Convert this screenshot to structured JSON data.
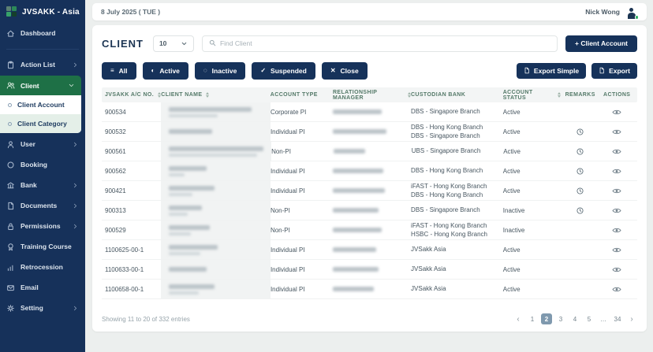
{
  "colors": {
    "sidebar_navy": "#16315a",
    "active_green": "#1e7046",
    "submenu_light_green": "#e4efe8",
    "button_navy": "#16325a",
    "table_header_green": "#547968",
    "pagination_active": "#7f99ae",
    "status_online_green": "#2fae63"
  },
  "header": {
    "date": "8 July 2025 ( TUE )",
    "user_name": "Nick Wong"
  },
  "sidebar": {
    "brand": "JVSAKK - Asia",
    "items": [
      {
        "label": "Dashboard",
        "icon": "home-icon"
      },
      {
        "label": "Action List",
        "icon": "clipboard-icon",
        "chevron": "right"
      },
      {
        "label": "Client",
        "icon": "users-icon",
        "chevron": "down",
        "active": true,
        "children": [
          {
            "label": "Client Account",
            "selected": true
          },
          {
            "label": "Client Category"
          }
        ]
      },
      {
        "label": "User",
        "icon": "user-icon",
        "chevron": "right"
      },
      {
        "label": "Booking",
        "icon": "circle-icon"
      },
      {
        "label": "Bank",
        "icon": "bank-icon",
        "chevron": "right"
      },
      {
        "label": "Documents",
        "icon": "document-icon",
        "chevron": "right"
      },
      {
        "label": "Permissions",
        "icon": "lock-icon",
        "chevron": "right"
      },
      {
        "label": "Training Course",
        "icon": "badge-icon"
      },
      {
        "label": "Retrocession",
        "icon": "chart-icon"
      },
      {
        "label": "Email",
        "icon": "envelope-icon"
      },
      {
        "label": "Setting",
        "icon": "gear-icon",
        "chevron": "right"
      }
    ]
  },
  "toolbar": {
    "title": "CLIENT",
    "page_size": "10",
    "search_placeholder": "Find Client",
    "add_button": "+ Client Account"
  },
  "filters": [
    {
      "label": "All",
      "icon": "menu-icon"
    },
    {
      "label": "Active",
      "icon": "contrast-icon"
    },
    {
      "label": "Inactive",
      "icon": "dotted-circle-icon"
    },
    {
      "label": "Suspended",
      "icon": "check-icon"
    },
    {
      "label": "Close",
      "icon": "x-icon"
    }
  ],
  "export": {
    "simple": "Export Simple",
    "full": "Export"
  },
  "table": {
    "columns": [
      {
        "label": "JVSAKK A/C NO.",
        "sortable": true
      },
      {
        "label": "CLIENT NAME",
        "sortable": true
      },
      {
        "label": "ACCOUNT TYPE",
        "sortable": false
      },
      {
        "label": "RELATIONSHIP MANAGER",
        "sortable": true
      },
      {
        "label": "CUSTODIAN BANK",
        "sortable": false
      },
      {
        "label": "ACCOUNT STATUS",
        "sortable": true
      },
      {
        "label": "REMARKS",
        "sortable": false
      },
      {
        "label": "ACTIONS",
        "sortable": false
      }
    ],
    "rows": [
      {
        "acc_no": "900534",
        "client_name_redacted": true,
        "name_lines": [
          105,
          62
        ],
        "type": "Corporate PI",
        "rm_redacted": true,
        "rm_w": 62,
        "banks": [
          "DBS - Singapore Branch"
        ],
        "status": "Active",
        "remark_clock": false
      },
      {
        "acc_no": "900532",
        "client_name_redacted": true,
        "name_lines": [
          55
        ],
        "type": "Individual PI",
        "rm_redacted": true,
        "rm_w": 68,
        "banks": [
          "DBS - Hong Kong Branch",
          "DBS - Singapore Branch"
        ],
        "status": "Active",
        "remark_clock": true
      },
      {
        "acc_no": "900561",
        "client_name_redacted": true,
        "name_lines": [
          120,
          112
        ],
        "type": "Non-PI",
        "rm_redacted": true,
        "rm_w": 40,
        "banks": [
          "UBS - Singapore Branch"
        ],
        "status": "Active",
        "remark_clock": true
      },
      {
        "acc_no": "900562",
        "client_name_redacted": true,
        "name_lines": [
          48,
          20
        ],
        "type": "Individual PI",
        "rm_redacted": true,
        "rm_w": 64,
        "banks": [
          "DBS - Hong Kong Branch"
        ],
        "status": "Active",
        "remark_clock": true
      },
      {
        "acc_no": "900421",
        "client_name_redacted": true,
        "name_lines": [
          58,
          30
        ],
        "type": "Individual PI",
        "rm_redacted": true,
        "rm_w": 66,
        "banks": [
          "iFAST - Hong Kong Branch",
          "DBS - Hong Kong Branch"
        ],
        "status": "Active",
        "remark_clock": true
      },
      {
        "acc_no": "900313",
        "client_name_redacted": true,
        "name_lines": [
          42,
          24
        ],
        "type": "Non-PI",
        "rm_redacted": true,
        "rm_w": 58,
        "banks": [
          "DBS - Singapore Branch"
        ],
        "status": "Inactive",
        "remark_clock": true
      },
      {
        "acc_no": "900529",
        "client_name_redacted": true,
        "name_lines": [
          52,
          28
        ],
        "type": "Non-PI",
        "rm_redacted": true,
        "rm_w": 62,
        "banks": [
          "iFAST - Hong Kong Branch",
          "HSBC - Hong Kong Branch"
        ],
        "status": "Inactive",
        "remark_clock": false
      },
      {
        "acc_no": "1100625-00-1",
        "client_name_redacted": true,
        "name_lines": [
          62,
          40
        ],
        "type": "Individual PI",
        "rm_redacted": true,
        "rm_w": 55,
        "banks": [
          "JVSakk Asia"
        ],
        "status": "Active",
        "remark_clock": false
      },
      {
        "acc_no": "1100633-00-1",
        "client_name_redacted": true,
        "name_lines": [
          48
        ],
        "type": "Individual PI",
        "rm_redacted": true,
        "rm_w": 58,
        "banks": [
          "JVSakk Asia"
        ],
        "status": "Active",
        "remark_clock": false
      },
      {
        "acc_no": "1100658-00-1",
        "client_name_redacted": true,
        "name_lines": [
          58,
          38
        ],
        "type": "Individual PI",
        "rm_redacted": true,
        "rm_w": 52,
        "banks": [
          "JVSakk Asia"
        ],
        "status": "Active",
        "remark_clock": false
      }
    ]
  },
  "footer": {
    "showing": "Showing 11 to 20 of 332 entries",
    "prev": "‹",
    "next": "›",
    "pages": [
      "1",
      "2",
      "3",
      "4",
      "5",
      "...",
      "34"
    ],
    "active_page": "2"
  }
}
